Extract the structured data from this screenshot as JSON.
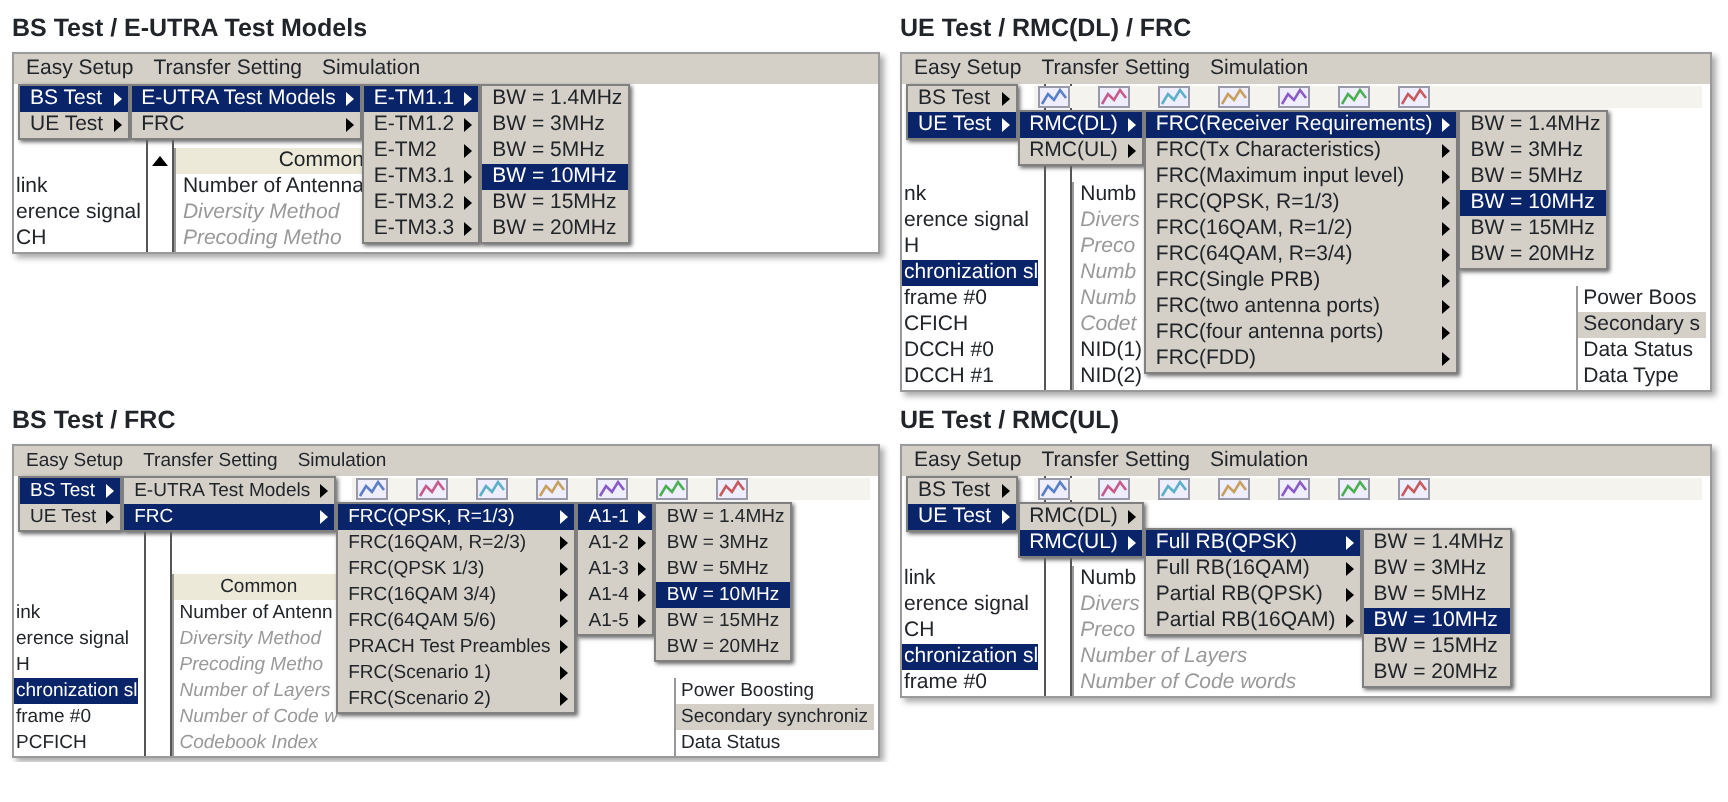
{
  "panels": [
    {
      "caption": "BS Test / E-UTRA Test Models",
      "menubar": [
        {
          "label": "Easy Setup"
        },
        {
          "label": "Transfer Setting"
        },
        {
          "label": "Simulation"
        }
      ],
      "toolbar": false,
      "scroll_arrow": true,
      "left_list": [
        {
          "label": "link",
          "selected": false
        },
        {
          "label": "erence signal",
          "selected": false
        },
        {
          "label": "CH",
          "selected": false
        }
      ],
      "table": {
        "header": "Common",
        "rows": [
          {
            "label": "Number of Antenna",
            "kind": "normal"
          },
          {
            "label": "Diversity Method",
            "kind": "dim"
          },
          {
            "label": "Precoding Metho",
            "kind": "dim"
          }
        ]
      },
      "menus": [
        {
          "items": [
            {
              "label": "BS Test",
              "selected": true,
              "submenu": true
            },
            {
              "label": "UE Test",
              "selected": false,
              "submenu": true
            }
          ]
        },
        {
          "items": [
            {
              "label": "E-UTRA Test Models",
              "selected": true,
              "submenu": true
            },
            {
              "label": "FRC",
              "selected": false,
              "submenu": true
            }
          ]
        },
        {
          "items": [
            {
              "label": "E-TM1.1",
              "selected": true,
              "submenu": true
            },
            {
              "label": "E-TM1.2",
              "selected": false,
              "submenu": true
            },
            {
              "label": "E-TM2",
              "selected": false,
              "submenu": true
            },
            {
              "label": "E-TM3.1",
              "selected": false,
              "submenu": true
            },
            {
              "label": "E-TM3.2",
              "selected": false,
              "submenu": true
            },
            {
              "label": "E-TM3.3",
              "selected": false,
              "submenu": true
            }
          ]
        },
        {
          "items": [
            {
              "label": "BW = 1.4MHz",
              "selected": false,
              "submenu": false
            },
            {
              "label": "BW = 3MHz",
              "selected": false,
              "submenu": false
            },
            {
              "label": "BW = 5MHz",
              "selected": false,
              "submenu": false
            },
            {
              "label": "BW = 10MHz",
              "selected": true,
              "submenu": false
            },
            {
              "label": "BW = 15MHz",
              "selected": false,
              "submenu": false
            },
            {
              "label": "BW = 20MHz",
              "selected": false,
              "submenu": false
            }
          ]
        }
      ]
    },
    {
      "caption": "UE Test / RMC(DL) / FRC",
      "menubar": [
        {
          "label": "Easy Setup"
        },
        {
          "label": "Transfer Setting"
        },
        {
          "label": "Simulation"
        }
      ],
      "toolbar": true,
      "scroll_arrow": false,
      "left_list": [
        {
          "label": "nk",
          "selected": false
        },
        {
          "label": "erence signal",
          "selected": false
        },
        {
          "label": "H",
          "selected": false
        },
        {
          "label": "chronization sl",
          "selected": true
        },
        {
          "label": "frame #0",
          "selected": false
        },
        {
          "label": "CFICH",
          "selected": false
        },
        {
          "label": "DCCH #0",
          "selected": false
        },
        {
          "label": "DCCH #1",
          "selected": false
        }
      ],
      "table": {
        "rows": [
          {
            "label": "Numb",
            "kind": "normal"
          },
          {
            "label": "Divers",
            "kind": "dim"
          },
          {
            "label": "Preco",
            "kind": "dim"
          },
          {
            "label": "Numb",
            "kind": "dim"
          },
          {
            "label": "Numb",
            "kind": "dim"
          },
          {
            "label": "Codet",
            "kind": "dim"
          },
          {
            "label": "NID(1)",
            "kind": "normal"
          },
          {
            "label": "NID(2)",
            "kind": "normal"
          }
        ]
      },
      "right_list": [
        {
          "label": "Power Boos",
          "shaded": false
        },
        {
          "label": "Secondary s",
          "shaded": true
        },
        {
          "label": "Data Status",
          "shaded": false
        },
        {
          "label": "Data Type",
          "shaded": false
        }
      ],
      "menus": [
        {
          "items": [
            {
              "label": "BS Test",
              "selected": false,
              "submenu": true
            },
            {
              "label": "UE Test",
              "selected": true,
              "submenu": true
            }
          ]
        },
        {
          "items": [
            {
              "label": "RMC(DL)",
              "selected": true,
              "submenu": true
            },
            {
              "label": "RMC(UL)",
              "selected": false,
              "submenu": true
            }
          ]
        },
        {
          "items": [
            {
              "label": "FRC(Receiver Requirements)",
              "selected": true,
              "submenu": true
            },
            {
              "label": "FRC(Tx Characteristics)",
              "selected": false,
              "submenu": true
            },
            {
              "label": "FRC(Maximum input level)",
              "selected": false,
              "submenu": true
            },
            {
              "label": "FRC(QPSK, R=1/3)",
              "selected": false,
              "submenu": true
            },
            {
              "label": "FRC(16QAM, R=1/2)",
              "selected": false,
              "submenu": true
            },
            {
              "label": "FRC(64QAM, R=3/4)",
              "selected": false,
              "submenu": true
            },
            {
              "label": "FRC(Single PRB)",
              "selected": false,
              "submenu": true
            },
            {
              "label": "FRC(two antenna ports)",
              "selected": false,
              "submenu": true
            },
            {
              "label": "FRC(four antenna ports)",
              "selected": false,
              "submenu": true
            },
            {
              "label": "FRC(FDD)",
              "selected": false,
              "submenu": true
            }
          ]
        },
        {
          "items": [
            {
              "label": "BW = 1.4MHz",
              "selected": false,
              "submenu": false
            },
            {
              "label": "BW = 3MHz",
              "selected": false,
              "submenu": false
            },
            {
              "label": "BW = 5MHz",
              "selected": false,
              "submenu": false
            },
            {
              "label": "BW = 10MHz",
              "selected": true,
              "submenu": false
            },
            {
              "label": "BW = 15MHz",
              "selected": false,
              "submenu": false
            },
            {
              "label": "BW = 20MHz",
              "selected": false,
              "submenu": false
            }
          ]
        }
      ]
    },
    {
      "caption": "BS Test / FRC",
      "menubar": [
        {
          "label": "Easy Setup"
        },
        {
          "label": "Transfer Setting"
        },
        {
          "label": "Simulation"
        }
      ],
      "toolbar": true,
      "scroll_arrow": false,
      "left_list": [
        {
          "label": "ink",
          "selected": false
        },
        {
          "label": "erence signal",
          "selected": false
        },
        {
          "label": "H",
          "selected": false
        },
        {
          "label": "chronization sl",
          "selected": true
        },
        {
          "label": "frame #0",
          "selected": false
        },
        {
          "label": "PCFICH",
          "selected": false
        }
      ],
      "table": {
        "header": "Common",
        "rows": [
          {
            "label": "Number of Antenn",
            "kind": "normal"
          },
          {
            "label": "Diversity Method",
            "kind": "dim"
          },
          {
            "label": "Precoding Metho",
            "kind": "dim"
          },
          {
            "label": "Number of Layers",
            "kind": "dim"
          },
          {
            "label": "Number of Code w",
            "kind": "dim"
          },
          {
            "label": "Codebook Index",
            "kind": "dim"
          }
        ]
      },
      "right_list": [
        {
          "label": "Power Boosting",
          "shaded": false
        },
        {
          "label": "Secondary synchroniz",
          "shaded": true
        },
        {
          "label": "Data Status",
          "shaded": false
        }
      ],
      "menus": [
        {
          "items": [
            {
              "label": "BS Test",
              "selected": true,
              "submenu": true
            },
            {
              "label": "UE Test",
              "selected": false,
              "submenu": true
            }
          ]
        },
        {
          "items": [
            {
              "label": "E-UTRA Test Models",
              "selected": false,
              "submenu": true
            },
            {
              "label": "FRC",
              "selected": true,
              "submenu": true
            }
          ]
        },
        {
          "items": [
            {
              "label": "FRC(QPSK, R=1/3)",
              "selected": true,
              "submenu": true
            },
            {
              "label": "FRC(16QAM, R=2/3)",
              "selected": false,
              "submenu": true
            },
            {
              "label": "FRC(QPSK 1/3)",
              "selected": false,
              "submenu": true
            },
            {
              "label": "FRC(16QAM 3/4)",
              "selected": false,
              "submenu": true
            },
            {
              "label": "FRC(64QAM 5/6)",
              "selected": false,
              "submenu": true
            },
            {
              "label": "PRACH Test Preambles",
              "selected": false,
              "submenu": true
            },
            {
              "label": "FRC(Scenario 1)",
              "selected": false,
              "submenu": true
            },
            {
              "label": "FRC(Scenario 2)",
              "selected": false,
              "submenu": true
            }
          ]
        },
        {
          "items": [
            {
              "label": "A1-1",
              "selected": true,
              "submenu": true
            },
            {
              "label": "A1-2",
              "selected": false,
              "submenu": true
            },
            {
              "label": "A1-3",
              "selected": false,
              "submenu": true
            },
            {
              "label": "A1-4",
              "selected": false,
              "submenu": true
            },
            {
              "label": "A1-5",
              "selected": false,
              "submenu": true
            }
          ]
        },
        {
          "items": [
            {
              "label": "BW = 1.4MHz",
              "selected": false,
              "submenu": false
            },
            {
              "label": "BW = 3MHz",
              "selected": false,
              "submenu": false
            },
            {
              "label": "BW = 5MHz",
              "selected": false,
              "submenu": false
            },
            {
              "label": "BW = 10MHz",
              "selected": true,
              "submenu": false
            },
            {
              "label": "BW = 15MHz",
              "selected": false,
              "submenu": false
            },
            {
              "label": "BW = 20MHz",
              "selected": false,
              "submenu": false
            }
          ]
        }
      ]
    },
    {
      "caption": "UE Test / RMC(UL)",
      "menubar": [
        {
          "label": "Easy Setup"
        },
        {
          "label": "Transfer Setting"
        },
        {
          "label": "Simulation"
        }
      ],
      "toolbar": true,
      "scroll_arrow": false,
      "left_list": [
        {
          "label": "link",
          "selected": false
        },
        {
          "label": "erence signal",
          "selected": false
        },
        {
          "label": "CH",
          "selected": false
        },
        {
          "label": "chronization sl",
          "selected": true
        },
        {
          "label": "frame #0",
          "selected": false
        }
      ],
      "table": {
        "rows": [
          {
            "label": "Numb",
            "kind": "normal"
          },
          {
            "label": "Divers",
            "kind": "dim"
          },
          {
            "label": "Preco",
            "kind": "dim"
          },
          {
            "label": "Number of Layers",
            "kind": "dim"
          },
          {
            "label": "Number of Code words",
            "kind": "dim"
          }
        ]
      },
      "menus": [
        {
          "items": [
            {
              "label": "BS Test",
              "selected": false,
              "submenu": true
            },
            {
              "label": "UE Test",
              "selected": true,
              "submenu": true
            }
          ]
        },
        {
          "items": [
            {
              "label": "RMC(DL)",
              "selected": false,
              "submenu": true
            },
            {
              "label": "RMC(UL)",
              "selected": true,
              "submenu": true
            }
          ]
        },
        {
          "items": [
            {
              "label": "Full RB(QPSK)",
              "selected": true,
              "submenu": true
            },
            {
              "label": "Full RB(16QAM)",
              "selected": false,
              "submenu": true
            },
            {
              "label": "Partial RB(QPSK)",
              "selected": false,
              "submenu": true
            },
            {
              "label": "Partial RB(16QAM)",
              "selected": false,
              "submenu": true
            }
          ]
        },
        {
          "items": [
            {
              "label": "BW = 1.4MHz",
              "selected": false,
              "submenu": false
            },
            {
              "label": "BW = 3MHz",
              "selected": false,
              "submenu": false
            },
            {
              "label": "BW = 5MHz",
              "selected": false,
              "submenu": false
            },
            {
              "label": "BW = 10MHz",
              "selected": true,
              "submenu": false
            },
            {
              "label": "BW = 15MHz",
              "selected": false,
              "submenu": false
            },
            {
              "label": "BW = 20MHz",
              "selected": false,
              "submenu": false
            }
          ]
        }
      ]
    }
  ]
}
